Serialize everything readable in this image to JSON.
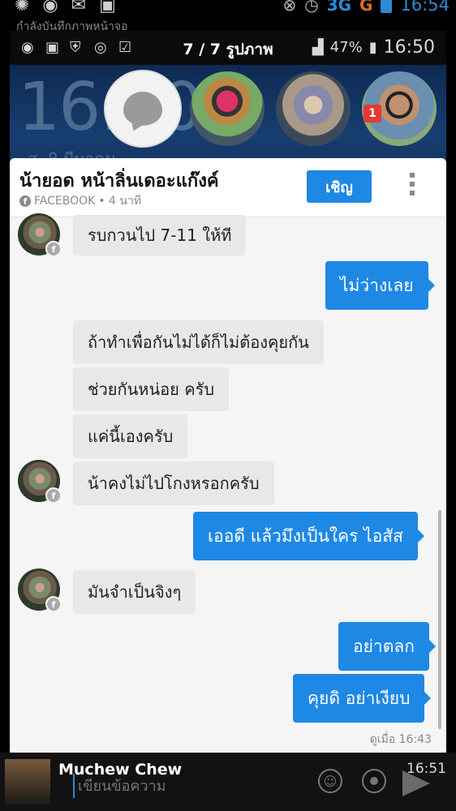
{
  "device_status": {
    "network": "3G",
    "carrier_g": "G",
    "time": "16:54"
  },
  "background_notification": "กำลังบันทึกภาพหน้าจอ",
  "viewer": {
    "counter": "7 / 7 รูปภาพ",
    "battery": "47%",
    "time": "16:50"
  },
  "lockscreen": {
    "clock": "16:50",
    "date": "ส. 8 มีนาคม"
  },
  "chat_heads": {
    "badge_count": "1"
  },
  "chat": {
    "contact_name": "น้ายอด หน้าลิ่นเดอะแก๊งค์",
    "source": "FACEBOOK",
    "elapsed": "• 4 นาที",
    "invite_label": "เชิญ",
    "messages": [
      {
        "dir": "in",
        "text": "รบกวนไป 7-11 ให้ที"
      },
      {
        "dir": "out",
        "text": "ไม่ว่างเลย"
      },
      {
        "dir": "in",
        "text": "ถ้าทำเพื่อกันไม่ได้ก็ไม่ต้องคุยกัน"
      },
      {
        "dir": "in",
        "text": "ช่วยกันหน่อย ครับ"
      },
      {
        "dir": "in",
        "text": "แค่นี้เองครับ"
      },
      {
        "dir": "in",
        "text": "น้าคงไม่ไปโกงหรอกครับ"
      },
      {
        "dir": "out",
        "text": "เออดี แล้วมึงเป็นใคร ไอสัส"
      },
      {
        "dir": "in",
        "text": "มันจำเป็นจิงๆ"
      },
      {
        "dir": "out",
        "text": "อย่าตลก"
      },
      {
        "dir": "out",
        "text": "คุยดิ อย่าเงียบ"
      }
    ],
    "seen_label": "ดูเมื่อ 16:43"
  },
  "composer": {
    "sender": "Muchew Chew",
    "time": "16:51",
    "placeholder": "เขียนข้อความ"
  }
}
